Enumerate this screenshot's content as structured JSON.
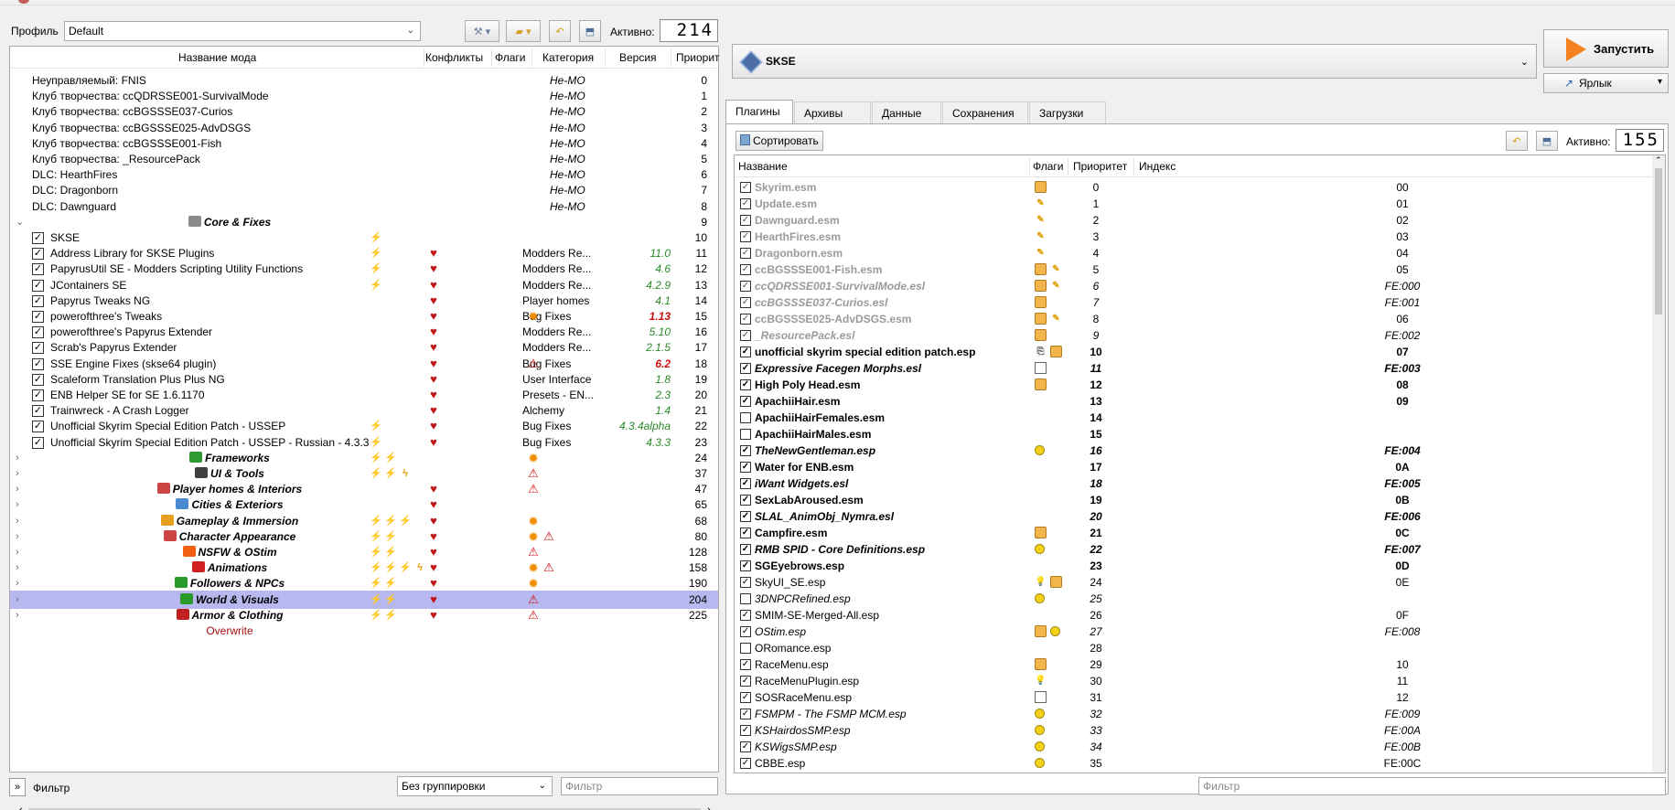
{
  "profile": {
    "label": "Профиль",
    "value": "Default"
  },
  "left_active": {
    "label": "Активно:",
    "count": "214"
  },
  "modlist_headers": {
    "name": "Название мода",
    "conflicts": "Конфликты",
    "flags": "Флаги",
    "category": "Категория",
    "version": "Версия",
    "priority": "Приорит"
  },
  "mods": [
    {
      "name": "Неуправляемый: FNIS",
      "cat": "Не-MO",
      "prio": "0"
    },
    {
      "name": "Клуб творчества: ccQDRSSE001-SurvivalMode",
      "cat": "Не-MO",
      "prio": "1"
    },
    {
      "name": "Клуб творчества: ccBGSSSE037-Curios",
      "cat": "Не-MO",
      "prio": "2"
    },
    {
      "name": "Клуб творчества: ccBGSSSE025-AdvDSGS",
      "cat": "Не-MO",
      "prio": "3"
    },
    {
      "name": "Клуб творчества: ccBGSSSE001-Fish",
      "cat": "Не-MO",
      "prio": "4"
    },
    {
      "name": "Клуб творчества: _ResourcePack",
      "cat": "Не-MO",
      "prio": "5"
    },
    {
      "name": "DLC: HearthFires",
      "cat": "Не-MO",
      "prio": "6"
    },
    {
      "name": "DLC: Dragonborn",
      "cat": "Не-MO",
      "prio": "7"
    },
    {
      "name": "DLC: Dawnguard",
      "cat": "Не-MO",
      "prio": "8"
    },
    {
      "name": "Core & Fixes",
      "prio": "9"
    },
    {
      "name": "SKSE",
      "prio": "10"
    },
    {
      "name": "Address Library for SKSE Plugins",
      "cat": "Modders Re...",
      "ver": "11.0",
      "prio": "11"
    },
    {
      "name": "PapyrusUtil SE - Modders Scripting Utility Functions",
      "cat": "Modders Re...",
      "ver": "4.6",
      "prio": "12"
    },
    {
      "name": "JContainers SE",
      "cat": "Modders Re...",
      "ver": "4.2.9",
      "prio": "13"
    },
    {
      "name": "Papyrus Tweaks NG",
      "cat": "Player homes",
      "ver": "4.1",
      "prio": "14"
    },
    {
      "name": "powerofthree's Tweaks",
      "cat": "Bug Fixes",
      "ver": "1.13",
      "prio": "15"
    },
    {
      "name": "powerofthree's Papyrus Extender",
      "cat": "Modders Re...",
      "ver": "5.10",
      "prio": "16"
    },
    {
      "name": "Scrab's Papyrus Extender",
      "cat": "Modders Re...",
      "ver": "2.1.5",
      "prio": "17"
    },
    {
      "name": "SSE Engine Fixes (skse64 plugin)",
      "cat": "Bug Fixes",
      "ver": "6.2",
      "prio": "18"
    },
    {
      "name": "Scaleform Translation Plus Plus NG",
      "cat": "User Interface",
      "ver": "1.8",
      "prio": "19"
    },
    {
      "name": "ENB Helper SE for SE 1.6.1170",
      "cat": "Presets - EN...",
      "ver": "2.3",
      "prio": "20"
    },
    {
      "name": "Trainwreck - A Crash Logger",
      "cat": "Alchemy",
      "ver": "1.4",
      "prio": "21"
    },
    {
      "name": "Unofficial Skyrim Special Edition Patch - USSEP",
      "cat": "Bug Fixes",
      "ver": "4.3.4alpha",
      "prio": "22"
    },
    {
      "name": "Unofficial Skyrim Special Edition Patch - USSEP - Russian - 4.3.3",
      "cat": "Bug Fixes",
      "ver": "4.3.3",
      "prio": "23"
    },
    {
      "name": "Frameworks",
      "prio": "24"
    },
    {
      "name": "UI & Tools",
      "prio": "37"
    },
    {
      "name": "Player homes & Interiors",
      "prio": "47"
    },
    {
      "name": "Cities & Exteriors",
      "prio": "65"
    },
    {
      "name": "Gameplay & Immersion",
      "prio": "68"
    },
    {
      "name": "Character Appearance",
      "prio": "80"
    },
    {
      "name": "NSFW & OStim",
      "prio": "128"
    },
    {
      "name": "Animations",
      "prio": "158"
    },
    {
      "name": "Followers & NPCs",
      "prio": "190"
    },
    {
      "name": "World & Visuals",
      "prio": "204"
    },
    {
      "name": "Armor & Clothing",
      "prio": "225"
    },
    {
      "name": "Overwrite",
      "prio": ""
    }
  ],
  "bottom_left": {
    "filter_label": "Фильтр",
    "group_value": "Без группировки",
    "filter_placeholder": "Фильтр"
  },
  "executable": {
    "name": "SKSE",
    "run_label": "Запустить",
    "shortcut_label": "Ярлык"
  },
  "tabs": [
    "Плагины",
    "Архивы",
    "Данные",
    "Сохранения",
    "Загрузки"
  ],
  "sort_label": "Сортировать",
  "right_active": {
    "label": "Активно:",
    "count": "155"
  },
  "plugin_headers": {
    "name": "Название",
    "flags": "Флаги",
    "priority": "Приоритет",
    "index": "Индекс"
  },
  "plugins": [
    {
      "name": "Skyrim.esm",
      "prio": "0",
      "idx": "00"
    },
    {
      "name": "Update.esm",
      "prio": "1",
      "idx": "01"
    },
    {
      "name": "Dawnguard.esm",
      "prio": "2",
      "idx": "02"
    },
    {
      "name": "HearthFires.esm",
      "prio": "3",
      "idx": "03"
    },
    {
      "name": "Dragonborn.esm",
      "prio": "4",
      "idx": "04"
    },
    {
      "name": "ccBGSSSE001-Fish.esm",
      "prio": "5",
      "idx": "05"
    },
    {
      "name": "ccQDRSSE001-SurvivalMode.esl",
      "prio": "6",
      "idx": "FE:000"
    },
    {
      "name": "ccBGSSSE037-Curios.esl",
      "prio": "7",
      "idx": "FE:001"
    },
    {
      "name": "ccBGSSSE025-AdvDSGS.esm",
      "prio": "8",
      "idx": "06"
    },
    {
      "name": "_ResourcePack.esl",
      "prio": "9",
      "idx": "FE:002"
    },
    {
      "name": "unofficial skyrim special edition patch.esp",
      "prio": "10",
      "idx": "07"
    },
    {
      "name": "Expressive Facegen Morphs.esl",
      "prio": "11",
      "idx": "FE:003"
    },
    {
      "name": "High Poly Head.esm",
      "prio": "12",
      "idx": "08"
    },
    {
      "name": "ApachiiHair.esm",
      "prio": "13",
      "idx": "09"
    },
    {
      "name": "ApachiiHairFemales.esm",
      "prio": "14",
      "idx": ""
    },
    {
      "name": "ApachiiHairMales.esm",
      "prio": "15",
      "idx": ""
    },
    {
      "name": "TheNewGentleman.esp",
      "prio": "16",
      "idx": "FE:004"
    },
    {
      "name": "Water for ENB.esm",
      "prio": "17",
      "idx": "0A"
    },
    {
      "name": "iWant Widgets.esl",
      "prio": "18",
      "idx": "FE:005"
    },
    {
      "name": "SexLabAroused.esm",
      "prio": "19",
      "idx": "0B"
    },
    {
      "name": "SLAL_AnimObj_Nymra.esl",
      "prio": "20",
      "idx": "FE:006"
    },
    {
      "name": "Campfire.esm",
      "prio": "21",
      "idx": "0C"
    },
    {
      "name": "RMB SPID - Core Definitions.esp",
      "prio": "22",
      "idx": "FE:007"
    },
    {
      "name": "SGEyebrows.esp",
      "prio": "23",
      "idx": "0D"
    },
    {
      "name": "SkyUI_SE.esp",
      "prio": "24",
      "idx": "0E"
    },
    {
      "name": "3DNPCRefined.esp",
      "prio": "25",
      "idx": ""
    },
    {
      "name": "SMIM-SE-Merged-All.esp",
      "prio": "26",
      "idx": "0F"
    },
    {
      "name": "OStim.esp",
      "prio": "27",
      "idx": "FE:008"
    },
    {
      "name": "ORomance.esp",
      "prio": "28",
      "idx": ""
    },
    {
      "name": "RaceMenu.esp",
      "prio": "29",
      "idx": "10"
    },
    {
      "name": "RaceMenuPlugin.esp",
      "prio": "30",
      "idx": "11"
    },
    {
      "name": "SOSRaceMenu.esp",
      "prio": "31",
      "idx": "12"
    },
    {
      "name": "FSMPM - The FSMP MCM.esp",
      "prio": "32",
      "idx": "FE:009"
    },
    {
      "name": "KSHairdosSMP.esp",
      "prio": "33",
      "idx": "FE:00A"
    },
    {
      "name": "KSWigsSMP.esp",
      "prio": "34",
      "idx": "FE:00B"
    },
    {
      "name": "CBBE.esp",
      "prio": "35",
      "idx": "FE:00C"
    }
  ],
  "bottom_right": {
    "filter_placeholder": "Фильтр"
  }
}
